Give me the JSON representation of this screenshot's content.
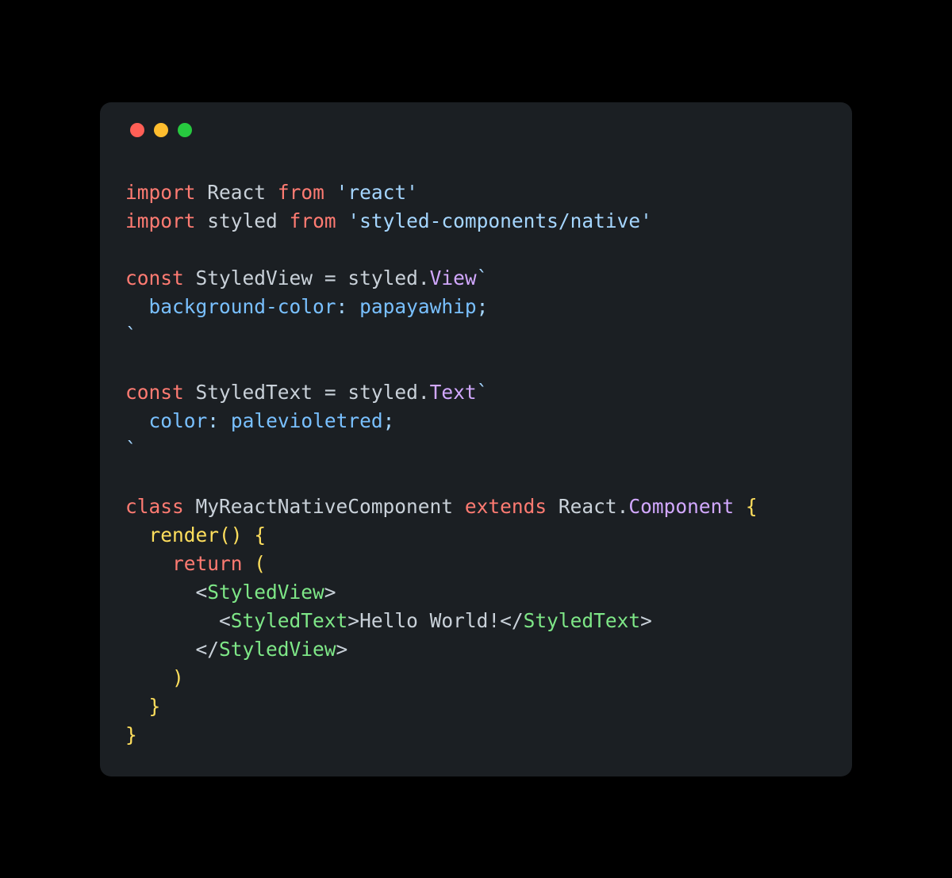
{
  "window": {
    "traffic_light_colors": {
      "red": "#ff5f56",
      "yellow": "#ffbd2e",
      "green": "#27c93f"
    }
  },
  "code": {
    "l1": {
      "kw1": "import",
      "id1": "React",
      "kw2": "from",
      "str1": "'react'"
    },
    "l2": {
      "kw1": "import",
      "id1": "styled",
      "kw2": "from",
      "str1": "'styled-components/native'"
    },
    "l4": {
      "kw1": "const",
      "id1": "StyledView",
      "eq": "=",
      "id2": "styled",
      "dot": ".",
      "prop1": "View",
      "bt": "`"
    },
    "l5": {
      "indent": "  ",
      "cssProp": "background-color",
      "colon": ":",
      "sp": " ",
      "cssVal": "papayawhip",
      "semi": ";"
    },
    "l6": {
      "bt": "`"
    },
    "l8": {
      "kw1": "const",
      "id1": "StyledText",
      "eq": "=",
      "id2": "styled",
      "dot": ".",
      "prop1": "Text",
      "bt": "`"
    },
    "l9": {
      "indent": "  ",
      "cssProp": "color",
      "colon": ":",
      "sp": " ",
      "cssVal": "palevioletred",
      "semi": ";"
    },
    "l10": {
      "bt": "`"
    },
    "l12": {
      "kw1": "class",
      "id1": "MyReactNativeComponent",
      "kw2": "extends",
      "id2": "React",
      "dot": ".",
      "prop1": "Component",
      "brace": "{"
    },
    "l13": {
      "indent": "  ",
      "fn": "render",
      "parens": "()",
      "brace": "{"
    },
    "l14": {
      "indent": "    ",
      "kw1": "return",
      "paren": "("
    },
    "l15": {
      "indent": "      ",
      "open": "<",
      "tag": "StyledView",
      "close": ">"
    },
    "l16": {
      "indent": "        ",
      "open1": "<",
      "tag1": "StyledText",
      "close1": ">",
      "text": "Hello World!",
      "open2": "</",
      "tag2": "StyledText",
      "close2": ">"
    },
    "l17": {
      "indent": "      ",
      "open": "</",
      "tag": "StyledView",
      "close": ">"
    },
    "l18": {
      "indent": "    ",
      "paren": ")"
    },
    "l19": {
      "indent": "  ",
      "brace": "}"
    },
    "l20": {
      "brace": "}"
    }
  }
}
